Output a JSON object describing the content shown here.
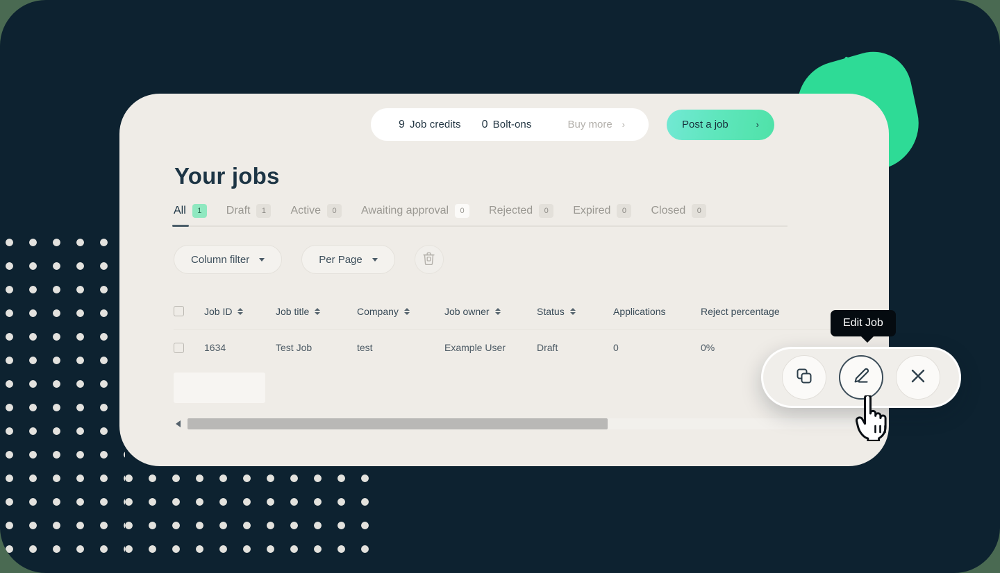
{
  "theme": {
    "frame_bg": "#0d2230",
    "outer_bg": "#4a6a52",
    "card_bg": "#efece7",
    "accent_green": "#2edb96",
    "badge_green": "#8fe8c0",
    "text_dark": "#1d3545"
  },
  "topbar": {
    "credits": [
      {
        "num": "9",
        "label": "Job credits"
      },
      {
        "num": "0",
        "label": "Bolt-ons"
      }
    ],
    "buy_more_label": "Buy more",
    "buy_more_chevron": "›",
    "post_job_label": "Post a job",
    "post_job_chevron": "›"
  },
  "page": {
    "title": "Your jobs"
  },
  "tabs": [
    {
      "label": "All",
      "count": "1",
      "active": true
    },
    {
      "label": "Draft",
      "count": "1",
      "active": false
    },
    {
      "label": "Active",
      "count": "0",
      "active": false
    },
    {
      "label": "Awaiting approval",
      "count": "0",
      "active": false
    },
    {
      "label": "Rejected",
      "count": "0",
      "active": false
    },
    {
      "label": "Expired",
      "count": "0",
      "active": false
    },
    {
      "label": "Closed",
      "count": "0",
      "active": false
    }
  ],
  "filters": {
    "column_filter_label": "Column filter",
    "per_page_label": "Per Page",
    "delete_icon": "trash-icon"
  },
  "table": {
    "columns": [
      {
        "key": "job_id",
        "label": "Job ID",
        "sortable": true
      },
      {
        "key": "job_title",
        "label": "Job title",
        "sortable": true
      },
      {
        "key": "company",
        "label": "Company",
        "sortable": true
      },
      {
        "key": "job_owner",
        "label": "Job owner",
        "sortable": true
      },
      {
        "key": "status",
        "label": "Status",
        "sortable": true
      },
      {
        "key": "applications",
        "label": "Applications",
        "sortable": false
      },
      {
        "key": "reject_percentage",
        "label": "Reject percentage",
        "sortable": false
      }
    ],
    "rows": [
      {
        "job_id": "1634",
        "job_title": "Test Job",
        "company": "test",
        "job_owner": "Example User",
        "status": "Draft",
        "applications": "0",
        "reject_percentage": "0%"
      }
    ]
  },
  "scrollbar": {
    "left_arrow": "scroll-left-icon",
    "right_arrow": "scroll-right-icon",
    "thumb_percent": "63"
  },
  "action_bar": {
    "tooltip_label": "Edit Job",
    "buttons": [
      {
        "name": "duplicate-job-button",
        "icon": "copy-icon",
        "focused": false
      },
      {
        "name": "edit-job-button",
        "icon": "pencil-icon",
        "focused": true
      },
      {
        "name": "close-job-button",
        "icon": "close-icon",
        "focused": false
      }
    ]
  }
}
